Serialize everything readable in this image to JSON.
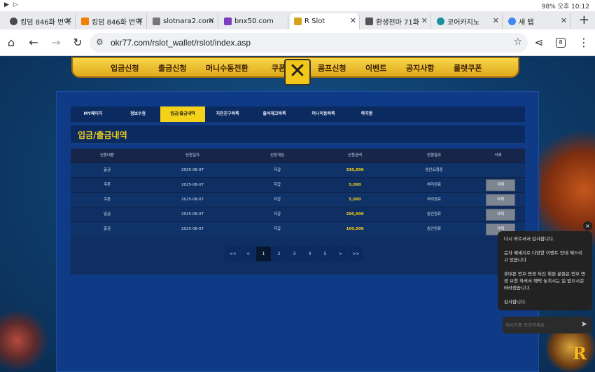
{
  "status_bar": {
    "left_icons": [
      "youtube-icon",
      "play-icon"
    ],
    "right_text": "98% 오후 10:12"
  },
  "browser": {
    "tabs": [
      {
        "label": "킹덤 846화 번역",
        "icon": "globe-icon",
        "active": false
      },
      {
        "label": "킹덤 846화 번역",
        "icon": "blogger-icon",
        "active": false
      },
      {
        "label": "slotnara2.com",
        "icon": "site-icon",
        "active": false
      },
      {
        "label": "bnx50.com",
        "icon": "site-50-icon",
        "active": false
      },
      {
        "label": "R Slot",
        "icon": "rslot-icon",
        "active": true
      },
      {
        "label": "환생천마 71화",
        "icon": "bars-icon",
        "active": false
      },
      {
        "label": "코어카지노",
        "icon": "globe-icon",
        "active": false
      },
      {
        "label": "새 탭",
        "icon": "chrome-icon",
        "active": false
      }
    ],
    "new_tab_symbol": "+",
    "url": "okr77.com/rslot_wallet/rslot/index.asp",
    "tab_count": "8"
  },
  "site": {
    "top_menu": [
      "입금신청",
      "출금신청",
      "머니수동전환",
      "쿠폰",
      "콤프신청",
      "이벤트",
      "공지사항",
      "룰렛쿠폰"
    ],
    "sub_tabs": [
      {
        "label": "MY페이지",
        "active": false
      },
      {
        "label": "정보수정",
        "active": false
      },
      {
        "label": "입금/출금내역",
        "active": true
      },
      {
        "label": "지인친구목록",
        "active": false
      },
      {
        "label": "출석체크목록",
        "active": false
      },
      {
        "label": "머니이동목록",
        "active": false
      },
      {
        "label": "쪽지함",
        "active": false
      }
    ],
    "section_title": "입금/출금내역",
    "table": {
      "headers": [
        "신청내용",
        "신청일자",
        "신청게임",
        "신청금액",
        "진행결과",
        "삭제"
      ],
      "rows": [
        {
          "type": "출금",
          "date": "2025-08-07",
          "game": "지갑",
          "amount": "330,000",
          "status": "승인요청중",
          "delete": ""
        },
        {
          "type": "쿠폰",
          "date": "2025-08-07",
          "game": "지갑",
          "amount": "5,000",
          "status": "처리완료",
          "delete": "삭제"
        },
        {
          "type": "쿠폰",
          "date": "2025-08-07",
          "game": "지갑",
          "amount": "5,000",
          "status": "처리완료",
          "delete": "삭제"
        },
        {
          "type": "입금",
          "date": "2025-08-07",
          "game": "지갑",
          "amount": "200,000",
          "status": "승인완료",
          "delete": "삭제"
        },
        {
          "type": "출금",
          "date": "2025-08-07",
          "game": "지갑",
          "amount": "100,000",
          "status": "승인완료",
          "delete": "삭제"
        }
      ]
    },
    "pagination": [
      "<<",
      "<",
      "1",
      "2",
      "3",
      "4",
      "5",
      ">",
      ">>"
    ],
    "current_page": "1"
  },
  "chat": {
    "messages": [
      "다시 와주셔서 감사합니다.",
      "문자 메세지로 다양한 이벤트 안내 해드리고 있습니다",
      "휴대폰 번호 변경 되신 회원 분들은 번호 변경 요청 하셔서 혜택 놓치시는 일 없으시길 바라겠습니다.",
      "감사합니다."
    ],
    "input_placeholder": "메시지를 작성하세요...",
    "close_symbol": "×"
  },
  "logo_letter": "R",
  "colors": {
    "accent": "#f5d21a",
    "panel": "#0f3a85",
    "background": "#0d3b6e"
  }
}
